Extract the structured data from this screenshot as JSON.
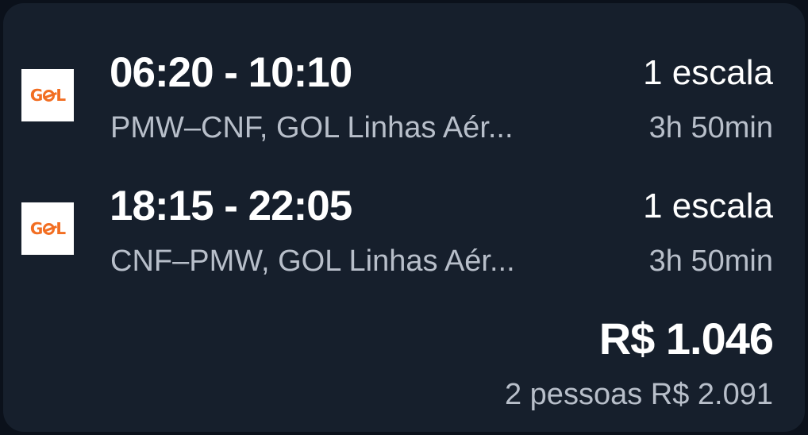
{
  "flights": [
    {
      "airline_logo": "GOL",
      "times": "06:20 - 10:10",
      "route": "PMW–CNF, GOL Linhas Aér...",
      "stops": "1 escala",
      "duration": "3h 50min"
    },
    {
      "airline_logo": "GOL",
      "times": "18:15 - 22:05",
      "route": "CNF–PMW, GOL Linhas Aér...",
      "stops": "1 escala",
      "duration": "3h 50min"
    }
  ],
  "price": {
    "per_person": "R$ 1.046",
    "total": "2 pessoas R$ 2.091"
  },
  "colors": {
    "background": "#161f2c",
    "logo_orange": "#f26e22",
    "secondary_text": "#b8bfca"
  }
}
